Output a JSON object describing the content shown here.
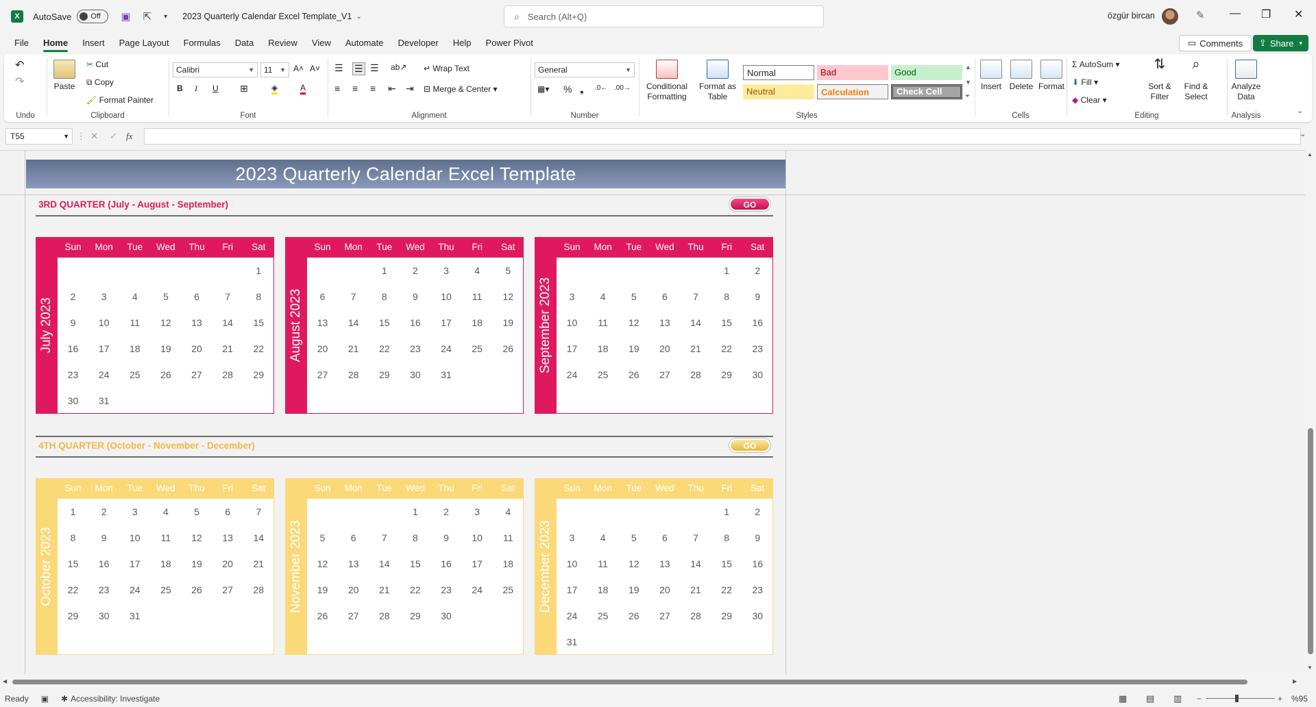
{
  "titlebar": {
    "autosave_label": "AutoSave",
    "autosave_state": "Off",
    "document_title": "2023 Quarterly Calendar Excel Template_V1",
    "search_placeholder": "Search (Alt+Q)",
    "user_name": "özgür bircan"
  },
  "menu": {
    "tabs": [
      "File",
      "Home",
      "Insert",
      "Page Layout",
      "Formulas",
      "Data",
      "Review",
      "View",
      "Automate",
      "Developer",
      "Help",
      "Power Pivot"
    ],
    "active": "Home",
    "comments_label": "Comments",
    "share_label": "Share"
  },
  "ribbon": {
    "undo_group": "Undo",
    "clipboard": {
      "paste": "Paste",
      "cut": "Cut",
      "copy": "Copy",
      "format_painter": "Format Painter",
      "label": "Clipboard"
    },
    "font": {
      "name": "Calibri",
      "size": "11",
      "bold": "B",
      "italic": "I",
      "underline": "U",
      "label": "Font"
    },
    "alignment": {
      "wrap_text": "Wrap Text",
      "merge_center": "Merge & Center",
      "label": "Alignment"
    },
    "number": {
      "format": "General",
      "label": "Number"
    },
    "styles": {
      "conditional_formatting": "Conditional Formatting",
      "format_as_table": "Format as Table",
      "normal": "Normal",
      "bad": "Bad",
      "good": "Good",
      "neutral": "Neutral",
      "calculation": "Calculation",
      "check_cell": "Check Cell",
      "label": "Styles"
    },
    "cells": {
      "insert": "Insert",
      "delete": "Delete",
      "format": "Format",
      "label": "Cells"
    },
    "editing": {
      "autosum": "AutoSum",
      "fill": "Fill",
      "clear": "Clear",
      "sort_filter": "Sort & Filter",
      "find_select": "Find & Select",
      "label": "Editing"
    },
    "analysis": {
      "analyze_data": "Analyze Data",
      "label": "Analysis"
    }
  },
  "formula_bar": {
    "name_box": "T55",
    "fx": "fx",
    "formula": ""
  },
  "sheet": {
    "title": "2023 Quarterly Calendar Excel Template",
    "weekdays": [
      "Sun",
      "Mon",
      "Tue",
      "Wed",
      "Thu",
      "Fri",
      "Sat"
    ],
    "go_label": "GO",
    "quarters": [
      {
        "heading": "3RD QUARTER (July - August - September)",
        "color": "#e0195f",
        "months": [
          {
            "name": "July 2023",
            "start": 6,
            "days": 31
          },
          {
            "name": "August 2023",
            "start": 2,
            "days": 31
          },
          {
            "name": "September 2023",
            "start": 5,
            "days": 30
          }
        ]
      },
      {
        "heading": "4TH QUARTER (October - November - December)",
        "color": "#fbd978",
        "months": [
          {
            "name": "October 2023",
            "start": 0,
            "days": 31
          },
          {
            "name": "November 2023",
            "start": 3,
            "days": 30
          },
          {
            "name": "December 2023",
            "start": 5,
            "days": 31
          }
        ]
      }
    ]
  },
  "statusbar": {
    "ready": "Ready",
    "accessibility": "Accessibility: Investigate",
    "zoom": "%95"
  }
}
